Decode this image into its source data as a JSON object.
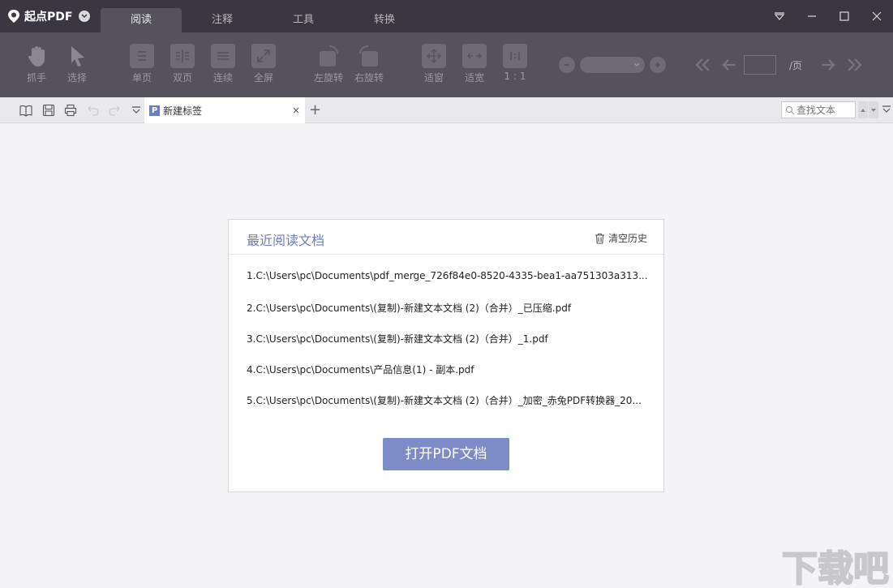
{
  "app": {
    "name": "起点PDF"
  },
  "main_tabs": [
    {
      "label": "阅读",
      "active": true
    },
    {
      "label": "注释"
    },
    {
      "label": "工具"
    },
    {
      "label": "转换"
    }
  ],
  "toolbar": {
    "grab": "抓手",
    "select": "选择",
    "single_page": "单页",
    "double_page": "双页",
    "continuous": "连续",
    "fullscreen": "全屏",
    "rotate_left": "左旋转",
    "rotate_right": "右旋转",
    "fit_window": "适窗",
    "fit_width": "适宽",
    "actual_size": "1 : 1",
    "page_suffix": "/页"
  },
  "tabbar": {
    "doc_tab_label": "新建标签",
    "doc_tab_icon_letter": "P",
    "close_glyph": "×",
    "add_glyph": "+",
    "search_placeholder": "查找文本"
  },
  "recent": {
    "title": "最近阅读文档",
    "clear_label": "清空历史",
    "items": [
      "1.C:\\Users\\pc\\Documents\\pdf_merge_726f84e0-8520-4335-bea1-aa751303a313...",
      "2.C:\\Users\\pc\\Documents\\(复制)-新建文本文档 (2)（合并）_已压缩.pdf",
      "3.C:\\Users\\pc\\Documents\\(复制)-新建文本文档 (2)（合并）_1.pdf",
      "4.C:\\Users\\pc\\Documents\\产品信息(1) - 副本.pdf",
      "5.C:\\Users\\pc\\Documents\\(复制)-新建文本文档 (2)（合并）_加密_赤兔PDF转换器_20..."
    ],
    "open_button": "打开PDF文档"
  },
  "watermark": {
    "text": "下载吧"
  },
  "colors": {
    "titlebar": "#3a3742",
    "toolbar": "#55525d",
    "accent": "#6d7dbe",
    "button": "#7d8bc6"
  }
}
